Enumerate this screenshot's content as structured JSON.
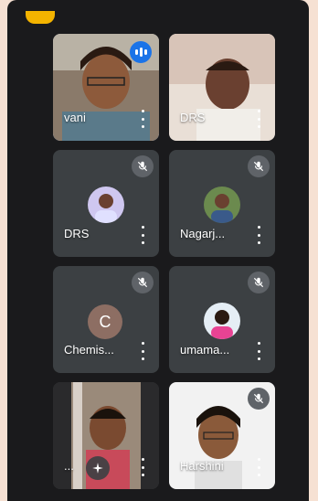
{
  "participants": [
    {
      "name": "vani",
      "state": "speaking"
    },
    {
      "name": "DRS",
      "state": "video"
    },
    {
      "name": "DRS",
      "state": "muted"
    },
    {
      "name": "Nagarj...",
      "state": "muted"
    },
    {
      "name": "Chemis...",
      "state": "muted",
      "avatar_letter": "C"
    },
    {
      "name": "umama...",
      "state": "muted"
    },
    {
      "name": "...",
      "state": "video"
    },
    {
      "name": "Harshini",
      "state": "muted"
    }
  ],
  "icons": {
    "speaking": "audio-level-icon",
    "muted": "mic-off-icon",
    "menu": "more-vert-icon",
    "effects": "sparkle-effects-icon"
  },
  "colors": {
    "page_bg": "#f6e1d3",
    "app_bg": "#1a1a1c",
    "tile_bg": "#3c4043",
    "speaking_blue": "#1a73e8",
    "active_border": "#8ab4f8",
    "muted_badge": "#5f6368",
    "top_chip": "#f4b400"
  }
}
